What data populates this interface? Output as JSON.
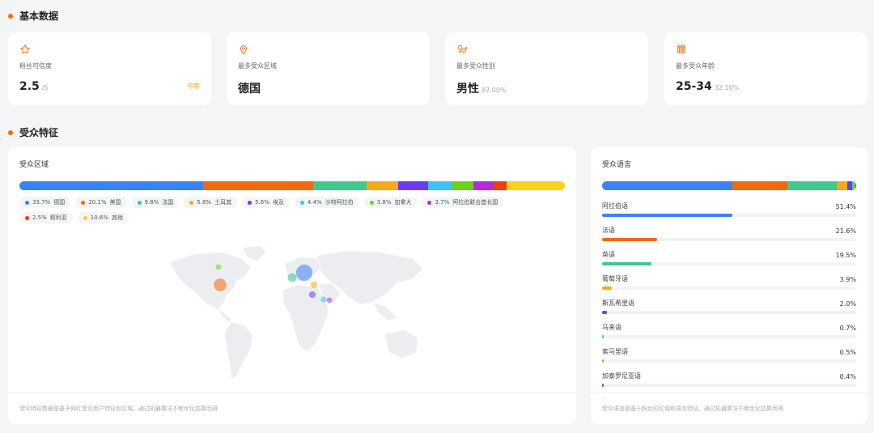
{
  "sections": {
    "basic": "基本数据",
    "audience": "受众特征"
  },
  "stats": [
    {
      "icon": "star-icon",
      "label": "粉丝可信度",
      "value": "2.5",
      "sub": "/5",
      "tag": "中等"
    },
    {
      "icon": "location-pin-icon",
      "label": "最多受众区域",
      "value": "德国",
      "sub": "",
      "tag": ""
    },
    {
      "icon": "gender-icon",
      "label": "最多受众性别",
      "value": "男性",
      "sub": "87.00%",
      "tag": ""
    },
    {
      "icon": "age-group-icon",
      "label": "最多受众年龄",
      "value": "25-34",
      "sub": "32.10%",
      "tag": ""
    }
  ],
  "region": {
    "title": "受众区域",
    "items": [
      {
        "pct": "33.7%",
        "name": "德国",
        "value": 33.7,
        "color": "#3b82f6"
      },
      {
        "pct": "20.1%",
        "name": "美国",
        "value": 20.1,
        "color": "#f26a0f"
      },
      {
        "pct": "9.8%",
        "name": "法国",
        "value": 9.8,
        "color": "#3ec98d"
      },
      {
        "pct": "5.8%",
        "name": "土耳其",
        "value": 5.8,
        "color": "#f8a815"
      },
      {
        "pct": "5.6%",
        "name": "埃及",
        "value": 5.6,
        "color": "#6a3cf0"
      },
      {
        "pct": "4.4%",
        "name": "沙特阿拉伯",
        "value": 4.4,
        "color": "#3dc3f5"
      },
      {
        "pct": "3.8%",
        "name": "加拿大",
        "value": 3.8,
        "color": "#6cd11a"
      },
      {
        "pct": "3.7%",
        "name": "阿拉伯联合酋长国",
        "value": 3.7,
        "color": "#b52be0"
      },
      {
        "pct": "2.5%",
        "name": "叙利亚",
        "value": 2.5,
        "color": "#f43b0c"
      },
      {
        "pct": "10.6%",
        "name": "其他",
        "value": 10.6,
        "color": "#f8d21b"
      }
    ],
    "footnote": "受众特征数据是基于网红受众用户特征和区域。通过机器算法不断优化估算而得"
  },
  "language": {
    "title": "受众语言",
    "items": [
      {
        "name": "阿拉伯语",
        "pct": "51.4%",
        "value": 51.4,
        "color": "#3b82f6"
      },
      {
        "name": "法语",
        "pct": "21.6%",
        "value": 21.6,
        "color": "#f26a0f"
      },
      {
        "name": "英语",
        "pct": "19.5%",
        "value": 19.5,
        "color": "#3ec98d"
      },
      {
        "name": "葡萄牙语",
        "pct": "3.9%",
        "value": 3.9,
        "color": "#f8a815"
      },
      {
        "name": "斯瓦希里语",
        "pct": "2.0%",
        "value": 2.0,
        "color": "#6a3cf0"
      },
      {
        "name": "马来语",
        "pct": "0.7%",
        "value": 0.7,
        "color": "#3dc3f5"
      },
      {
        "name": "索马里语",
        "pct": "0.5%",
        "value": 0.5,
        "color": "#6cd11a"
      },
      {
        "name": "加泰罗尼亚语",
        "pct": "0.4%",
        "value": 0.4,
        "color": "#b52be0"
      }
    ],
    "footnote": "受众语言是基于粉丝的区域和语言特征。通过机器算法不断优化估算而得"
  },
  "map_bubbles": [
    {
      "country": "德国",
      "value": 33.7,
      "color": "#3b82f6"
    },
    {
      "country": "美国",
      "value": 20.1,
      "color": "#f26a0f"
    },
    {
      "country": "法国",
      "value": 9.8,
      "color": "#3ec98d"
    },
    {
      "country": "土耳其",
      "value": 5.8,
      "color": "#f8a815"
    },
    {
      "country": "埃及",
      "value": 5.6,
      "color": "#6a3cf0"
    },
    {
      "country": "沙特阿拉伯",
      "value": 4.4,
      "color": "#3dc3f5"
    },
    {
      "country": "加拿大",
      "value": 3.8,
      "color": "#6cd11a"
    },
    {
      "country": "阿拉伯联合酋长国",
      "value": 3.7,
      "color": "#b52be0"
    }
  ]
}
